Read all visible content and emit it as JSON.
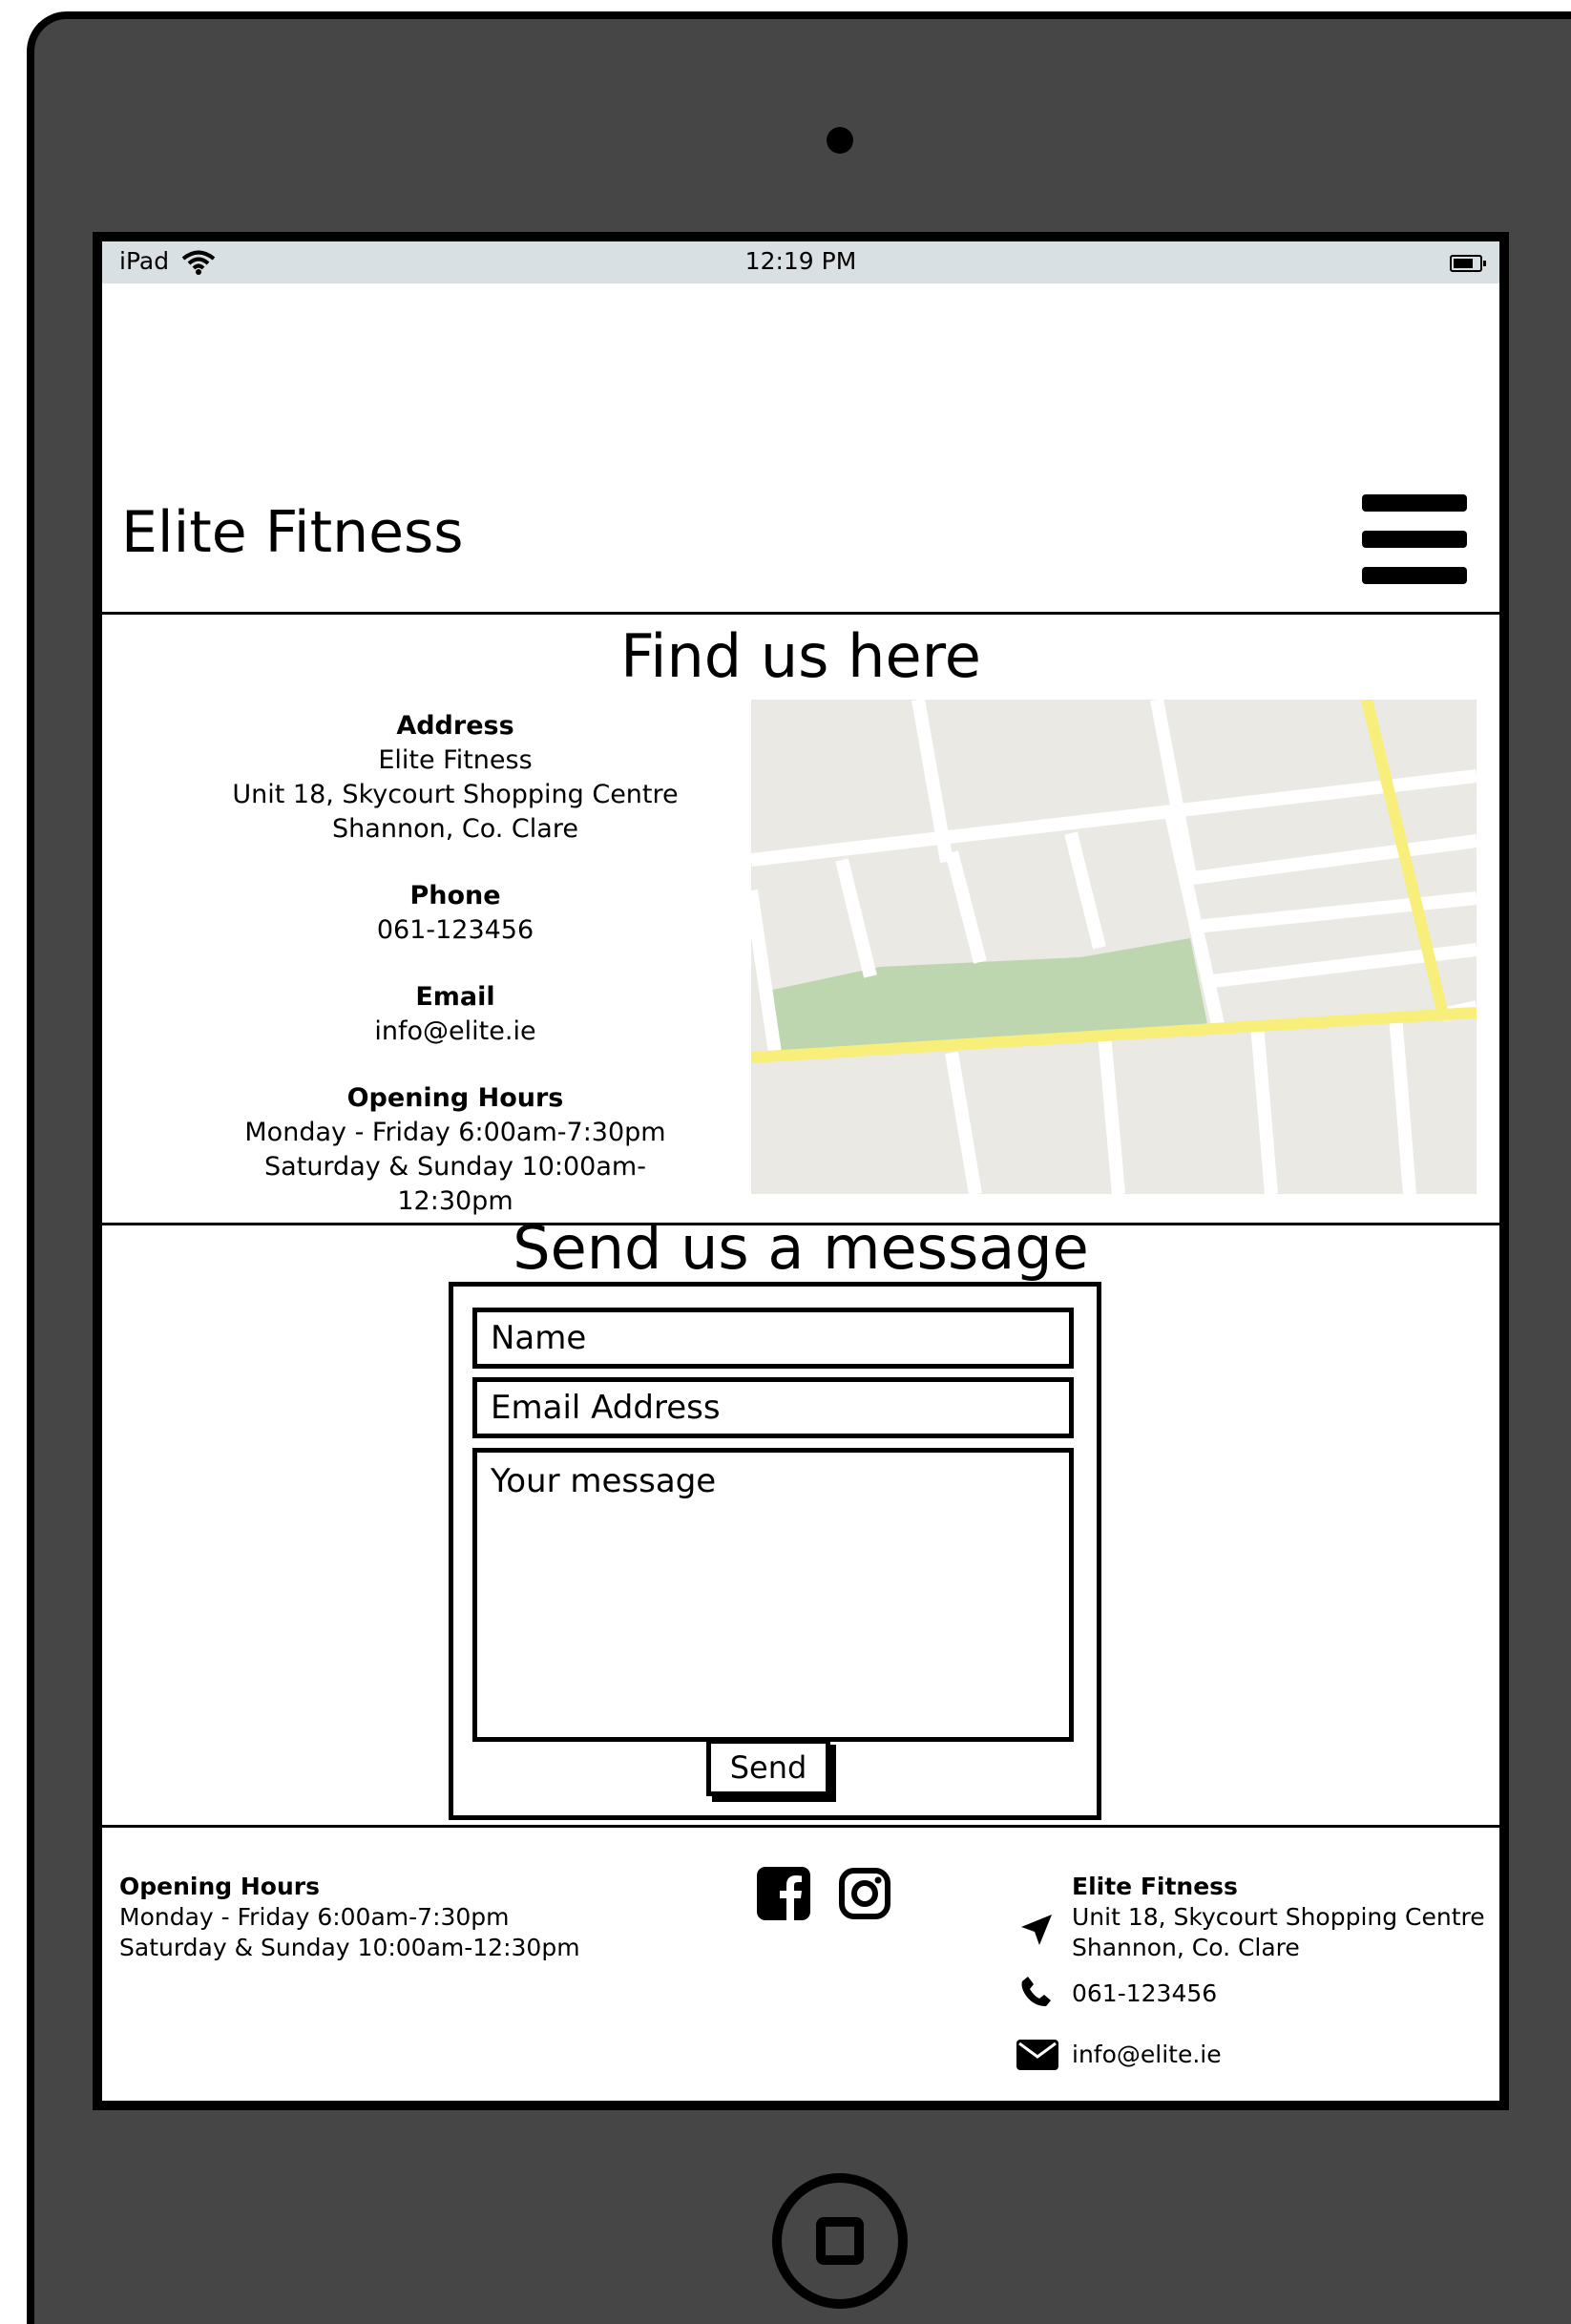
{
  "status_bar": {
    "carrier": "iPad",
    "time": "12:19 PM"
  },
  "header": {
    "brand": "Elite Fitness"
  },
  "find_us": {
    "heading": "Find us here",
    "address_label": "Address",
    "address_lines": [
      "Elite Fitness",
      "Unit 18, Skycourt Shopping Centre",
      "Shannon, Co. Clare"
    ],
    "phone_label": "Phone",
    "phone": "061-123456",
    "email_label": "Email",
    "email": "info@elite.ie",
    "hours_label": "Opening Hours",
    "hours_lines": [
      "Monday - Friday 6:00am-7:30pm",
      "Saturday & Sunday 10:00am-12:30pm"
    ]
  },
  "message": {
    "heading": "Send us a message",
    "name_placeholder": "Name",
    "email_placeholder": "Email Address",
    "message_placeholder": "Your message",
    "send_label": "Send"
  },
  "footer": {
    "hours_label": "Opening Hours",
    "hours_lines": [
      "Monday - Friday 6:00am-7:30pm",
      "Saturday & Sunday 10:00am-12:30pm"
    ],
    "company": "Elite Fitness",
    "address_lines": [
      "Unit 18, Skycourt Shopping Centre",
      "Shannon, Co. Clare"
    ],
    "phone": "061-123456",
    "email": "info@elite.ie",
    "social_icons": [
      "facebook-icon",
      "instagram-icon"
    ]
  },
  "colors": {
    "device": "#464646",
    "status_bar": "#d8e0e3",
    "map_land": "#ebe9e3",
    "map_park": "#bdd6b0",
    "map_road": "#f8ee7a"
  }
}
